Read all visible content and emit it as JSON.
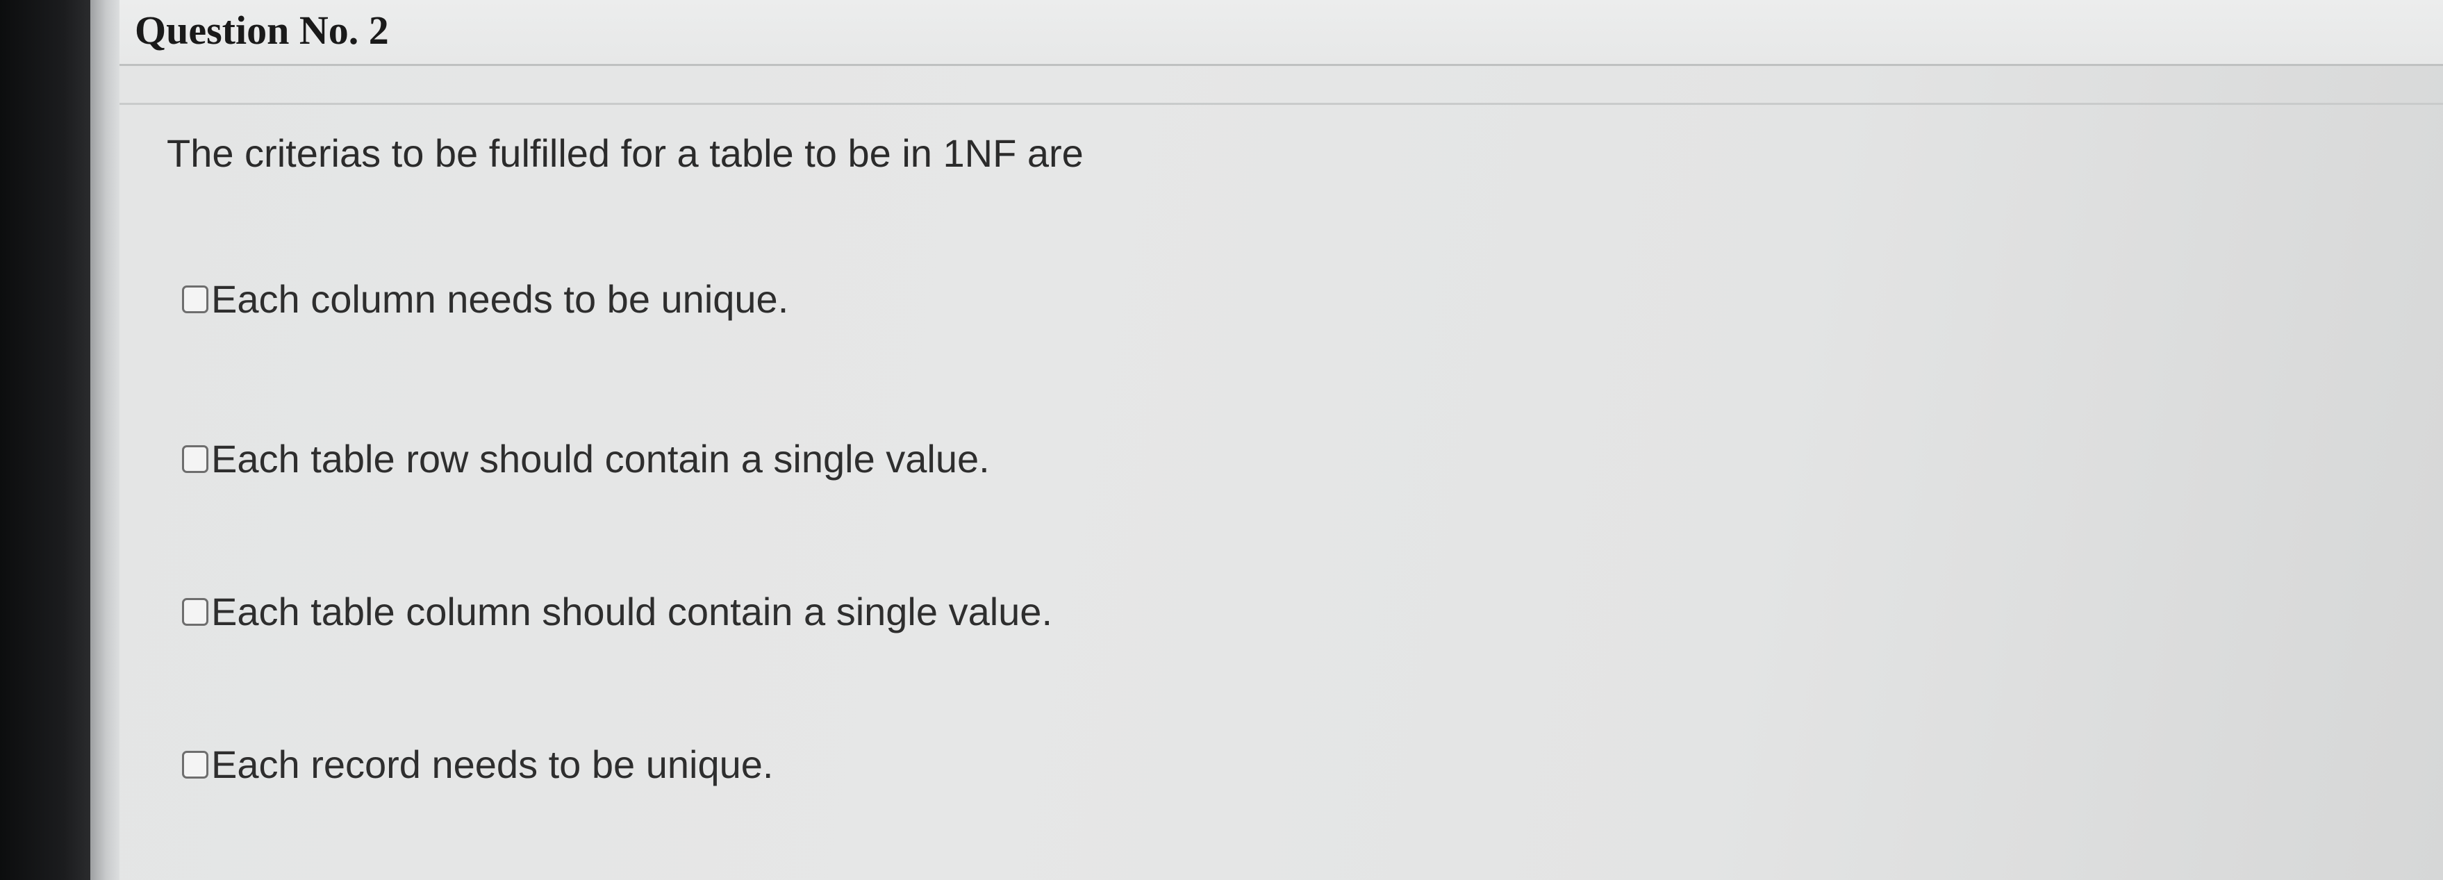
{
  "question": {
    "title": "Question No. 2",
    "text": "The criterias to be fulfilled for a table to be in 1NF are"
  },
  "options": [
    {
      "label": "Each column needs to be unique.",
      "checked": false
    },
    {
      "label": "Each table row should contain a single value.",
      "checked": false
    },
    {
      "label": "Each table column should contain a single value.",
      "checked": false
    },
    {
      "label": "Each record needs to be unique.",
      "checked": false
    }
  ]
}
